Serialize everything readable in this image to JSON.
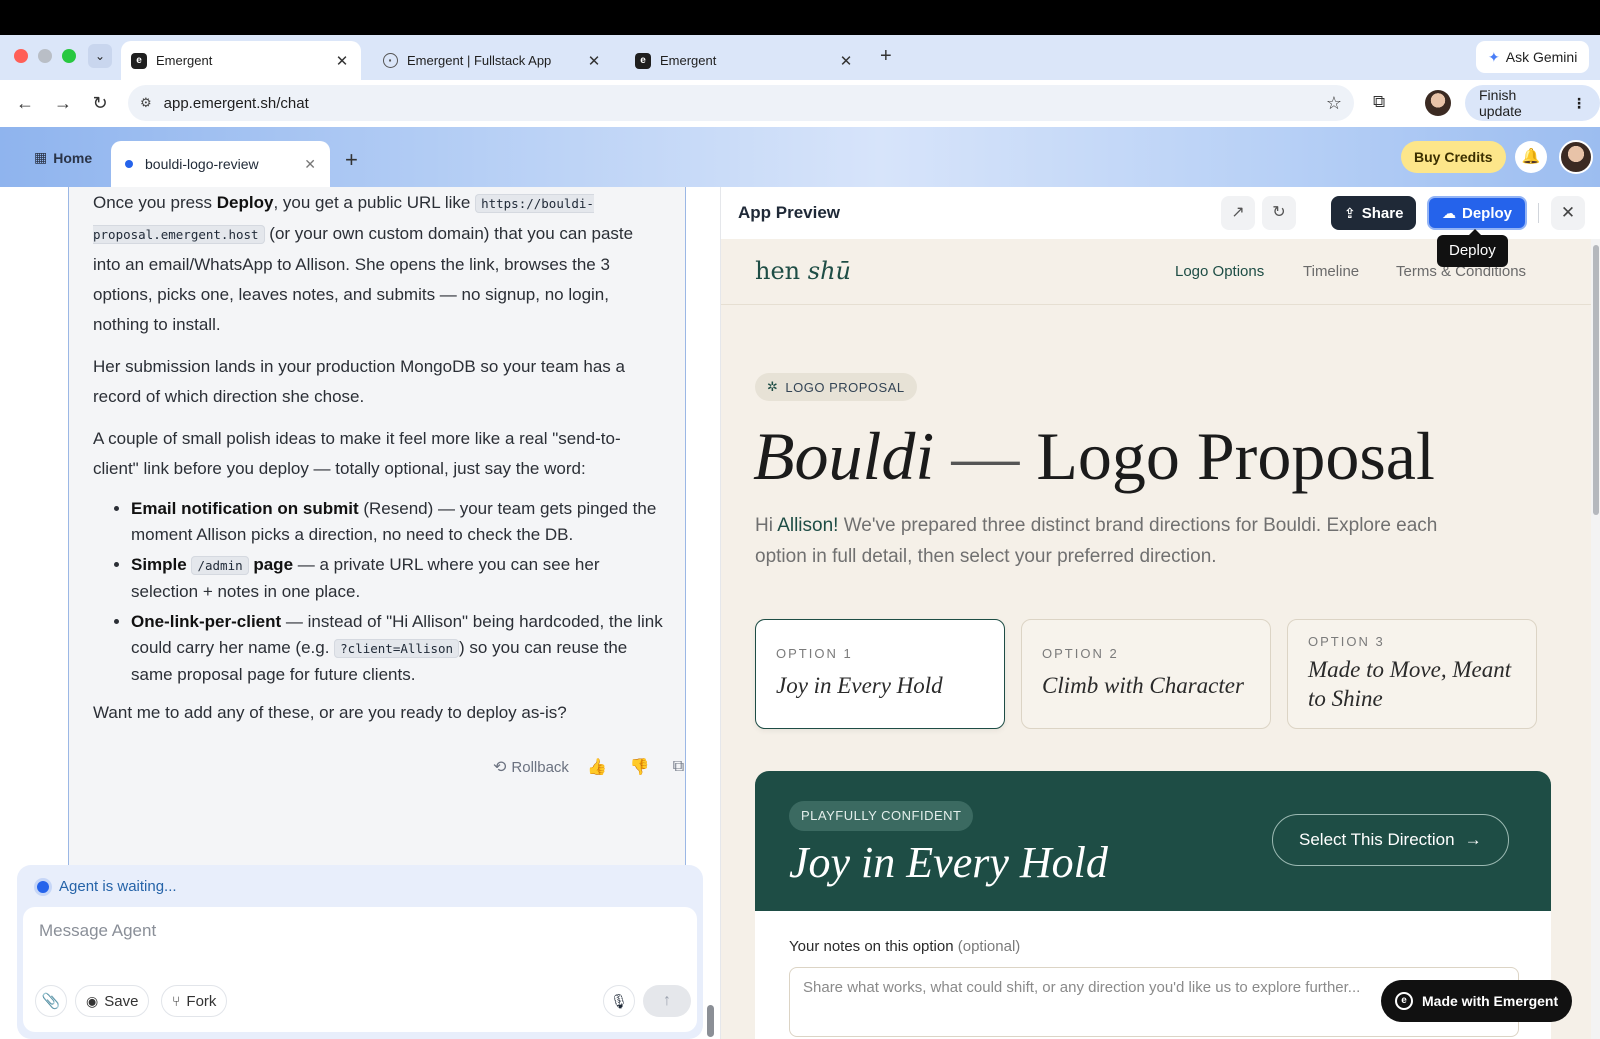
{
  "browser": {
    "tabs": [
      {
        "title": "Emergent",
        "active": true
      },
      {
        "title": "Emergent | Fullstack App",
        "active": false
      },
      {
        "title": "Emergent",
        "active": false
      }
    ],
    "new_tab": "+",
    "ask_gemini": "Ask Gemini",
    "url": "app.emergent.sh/chat",
    "finish_update": "Finish update"
  },
  "app": {
    "home": "Home",
    "tab_label": "bouldi-logo-review",
    "buy_credits": "Buy Credits"
  },
  "chat": {
    "p1_prefix": "Once you press ",
    "p1_deploy": "Deploy",
    "p1_mid": ", you get a public URL like ",
    "p1_url": "https://bouldi-proposal.emergent.host",
    "p1_suffix": " (or your own custom domain) that you can paste into an email/WhatsApp to Allison. She opens the link, browses the 3 options, picks one, leaves notes, and submits — no signup, no login, nothing to install.",
    "p2": "Her submission lands in your production MongoDB so your team has a record of which direction she chose.",
    "p3": "A couple of small polish ideas to make it feel more like a real \"send-to-client\" link before you deploy — totally optional, just say the word:",
    "b1_bold": "Email notification on submit",
    "b1_rest": " (Resend) — your team gets pinged the moment Allison picks a direction, no need to check the DB.",
    "b2_bold": "Simple ",
    "b2_code": "/admin",
    "b2_bold2": " page",
    "b2_rest": " — a private URL where you can see her selection + notes in one place.",
    "b3_bold": "One-link-per-client",
    "b3_mid": " — instead of \"Hi Allison\" being hardcoded, the link could carry her name (e.g. ",
    "b3_code": "?client=Allison",
    "b3_rest": ") so you can reuse the same proposal page for future clients.",
    "p4": "Want me to add any of these, or are you ready to deploy as-is?",
    "rollback": "Rollback",
    "agent_status": "Agent is waiting...",
    "input_placeholder": "Message Agent",
    "save": "Save",
    "fork": "Fork"
  },
  "preview": {
    "title": "App Preview",
    "share": "Share",
    "deploy": "Deploy",
    "tooltip": "Deploy",
    "site": {
      "brand_a": "hen ",
      "brand_b": "shū",
      "nav": [
        "Logo Options",
        "Timeline",
        "Terms & Conditions"
      ],
      "chip": "LOGO PROPOSAL",
      "title_italic": "Bouldi",
      "title_dash": " — ",
      "title_rest": "Logo Proposal",
      "sub_hi": "Hi ",
      "sub_name": "Allison!",
      "sub_rest": " We've prepared three distinct brand directions for Bouldi. Explore each option in full detail, then select your preferred direction.",
      "options": [
        {
          "label": "OPTION 1",
          "title": "Joy in Every Hold"
        },
        {
          "label": "OPTION 2",
          "title": "Climb with Character"
        },
        {
          "label": "OPTION 3",
          "title": "Made to Move, Meant to Shine"
        }
      ],
      "direction_chip": "PLAYFULLY CONFIDENT",
      "direction_title": "Joy in Every Hold",
      "select_direction": "Select This Direction",
      "notes_label": "Your notes on this option",
      "notes_hint": " (optional)",
      "notes_placeholder": "Share what works, what could shift, or any direction you'd like us to explore further..."
    },
    "made_with": "Made with Emergent"
  },
  "colors": {
    "accent_blue": "#2563eb",
    "brand_green": "#1e4d45",
    "cream": "#f5f0e8",
    "credits_yellow": "#fde68a"
  }
}
